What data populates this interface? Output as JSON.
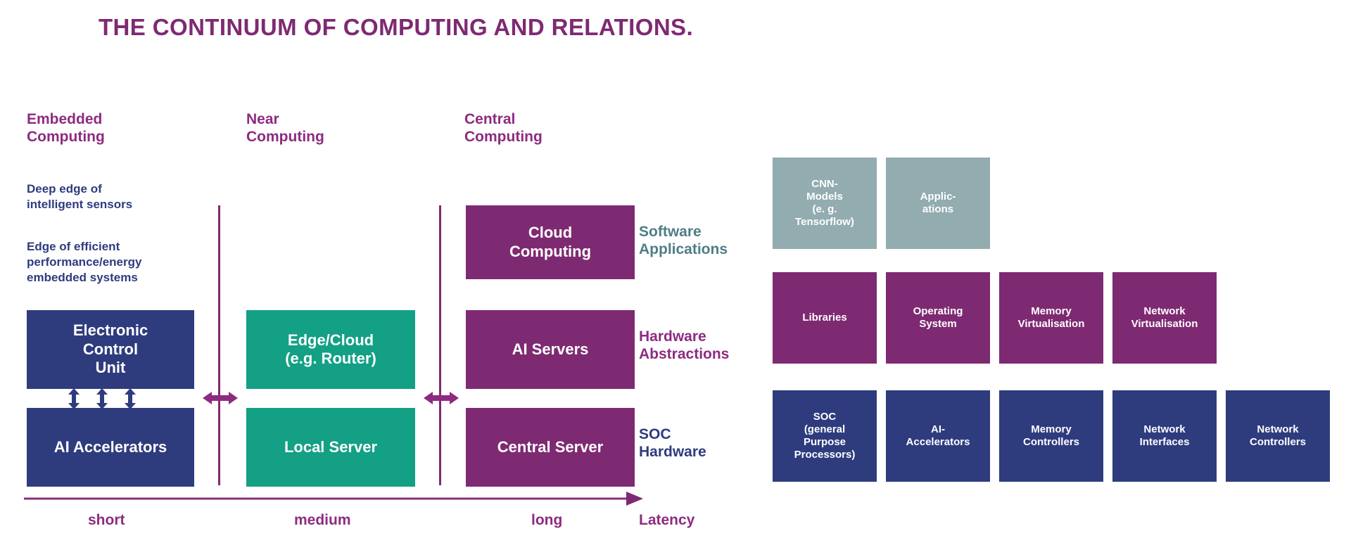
{
  "title": "THE CONTINUUM OF COMPUTING AND RELATIONS.",
  "colors": {
    "purple": "#7E2A72",
    "purple_text": "#8D2B80",
    "navy": "#2E3C7E",
    "green": "#13A085",
    "slate": "#92ACB0",
    "slate_text": "#4E7E86",
    "background": "#FFFFFF"
  },
  "columns": [
    {
      "heading": "Embedded\nComputing"
    },
    {
      "heading": "Near\nComputing"
    },
    {
      "heading": "Central\nComputing"
    }
  ],
  "notes": [
    "Deep edge of\nintelligent sensors",
    "Edge of efficient\nperformance/energy\nembedded systems"
  ],
  "embedded_boxes": [
    {
      "label": "Electronic\nControl\nUnit",
      "color": "navy"
    },
    {
      "label": "AI Accelerators",
      "color": "navy"
    }
  ],
  "near_boxes": [
    {
      "label": "Edge/Cloud\n(e.g. Router)",
      "color": "green"
    },
    {
      "label": "Local Server",
      "color": "green"
    }
  ],
  "central_boxes": [
    {
      "label": "Cloud\nComputing",
      "color": "plum"
    },
    {
      "label": "AI Servers",
      "color": "plum"
    },
    {
      "label": "Central Server",
      "color": "plum"
    }
  ],
  "roles": [
    {
      "label": "Software\nApplications",
      "color": "#4E7E86"
    },
    {
      "label": "Hardware\nAbstractions",
      "color": "#8D2B80"
    },
    {
      "label": "SOC\nHardware",
      "color": "#2E3C7E"
    }
  ],
  "latency_axis": {
    "name": "Latency",
    "ticks": [
      "short",
      "medium",
      "long"
    ],
    "direction": "increasing left to right"
  },
  "stack": {
    "rows": [
      {
        "layer": "Software Applications",
        "color": "slate",
        "boxes": [
          {
            "label": "CNN-\nModels\n(e. g.\nTensorflow)"
          },
          {
            "label": "Applic-\nations"
          }
        ]
      },
      {
        "layer": "Hardware Abstractions",
        "color": "plum",
        "boxes": [
          {
            "label": "Libraries"
          },
          {
            "label": "Operating\nSystem"
          },
          {
            "label": "Memory\nVirtualisation"
          },
          {
            "label": "Network\nVirtualisation"
          }
        ]
      },
      {
        "layer": "SOC Hardware",
        "color": "navy",
        "boxes": [
          {
            "label": "SOC\n(general\nPurpose\nProcessors)"
          },
          {
            "label": "AI-\nAccelerators"
          },
          {
            "label": "Memory\nControllers"
          },
          {
            "label": "Network\nInterfaces"
          },
          {
            "label": "Network\nControllers"
          }
        ]
      }
    ]
  },
  "connectors": {
    "vertical_pair_count": 3,
    "horizontal_arrows": 2,
    "dividers": 2
  }
}
